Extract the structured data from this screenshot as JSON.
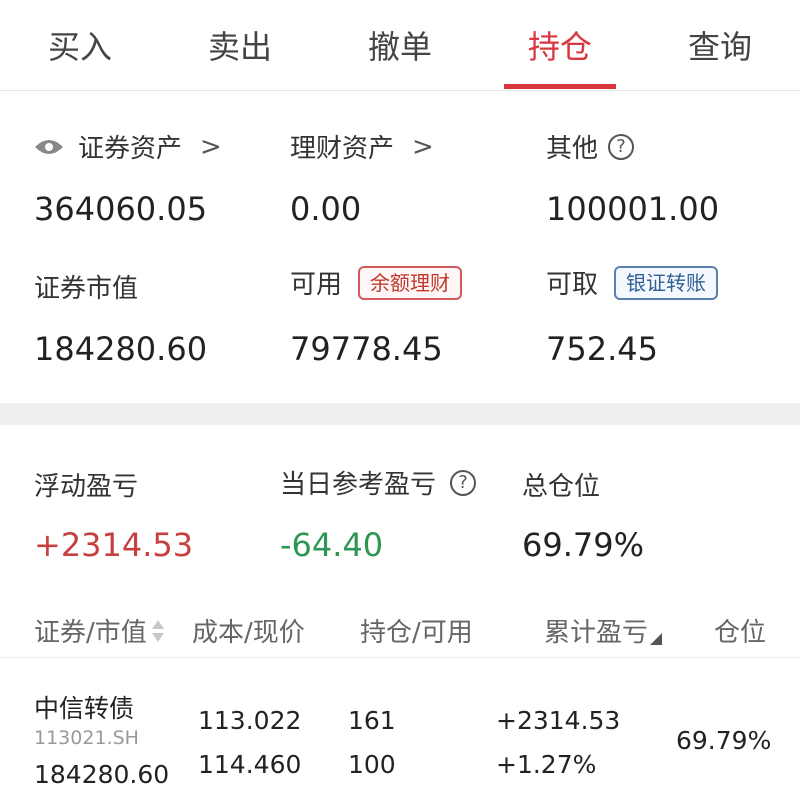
{
  "tabs": [
    {
      "label": "买入"
    },
    {
      "label": "卖出"
    },
    {
      "label": "撤单"
    },
    {
      "label": "持仓",
      "active": true
    },
    {
      "label": "查询"
    }
  ],
  "summary": {
    "securities_assets_label": "证券资产",
    "securities_assets_value": "364060.05",
    "wealth_assets_label": "理财资产",
    "wealth_assets_value": "0.00",
    "other_label": "其他",
    "other_value": "100001.00",
    "market_value_label": "证券市值",
    "market_value_value": "184280.60",
    "available_label": "可用",
    "available_badge": "余额理财",
    "available_value": "79778.45",
    "withdrawable_label": "可取",
    "withdrawable_badge": "银证转账",
    "withdrawable_value": "752.45",
    "arrow": ">",
    "help": "?"
  },
  "pnl": {
    "floating_label": "浮动盈亏",
    "floating_value": "+2314.53",
    "daily_label": "当日参考盈亏",
    "daily_value": "-64.40",
    "position_label": "总仓位",
    "position_value": "69.79%"
  },
  "table": {
    "headers": [
      "证券/市值",
      "成本/现价",
      "持仓/可用",
      "累计盈亏",
      "仓位"
    ],
    "rows": [
      {
        "name": "中信转债",
        "code": "113021.SH",
        "market_value": "184280.60",
        "cost": "113.022",
        "price": "114.460",
        "holding": "161",
        "available": "100",
        "pnl": "+2314.53",
        "pnl_pct": "+1.27%",
        "position": "69.79%"
      }
    ]
  },
  "colors": {
    "accent": "#d9363e",
    "gain": "#c64040",
    "loss": "#2e9654"
  }
}
